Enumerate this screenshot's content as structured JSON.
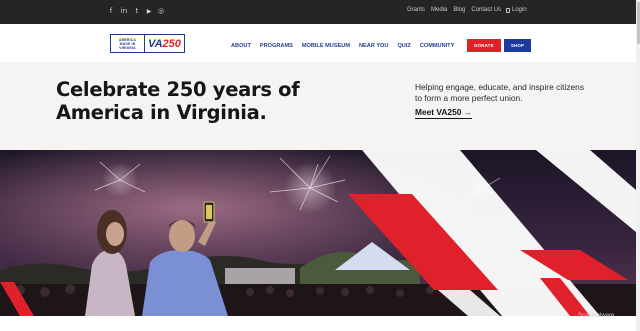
{
  "topbar": {
    "social": [
      {
        "icon": "facebook-icon",
        "glyph": "f"
      },
      {
        "icon": "linkedin-icon",
        "glyph": "in"
      },
      {
        "icon": "twitter-icon",
        "glyph": "t"
      },
      {
        "icon": "youtube-icon",
        "glyph": "▶"
      },
      {
        "icon": "instagram-icon",
        "glyph": "◎"
      }
    ],
    "links": [
      "Grants",
      "Media",
      "Blog",
      "Contact Us"
    ],
    "login_label": "Login"
  },
  "header": {
    "logo": {
      "line1": "AMERICA",
      "line2": "MADE IN",
      "line3": "VIRGINIA",
      "va": "VA",
      "num": "250"
    },
    "nav": [
      "ABOUT",
      "PROGRAMS",
      "MOBILE MUSEUM",
      "NEAR YOU",
      "QUIZ",
      "COMMUNITY"
    ],
    "donate_label": "DONATE",
    "shop_label": "SHOP"
  },
  "hero": {
    "title": "Celebrate 250 years of America in Virginia.",
    "subtitle": "Helping engage, educate, and inspire citizens to form a more perfect union.",
    "link_label": "Meet VA250",
    "link_arrow": "→"
  },
  "watermark": "ScanMalware",
  "colors": {
    "topbar": "#252525",
    "navy": "#243e8f",
    "red": "#e0202a",
    "hero_bg": "#f5f4f2"
  }
}
